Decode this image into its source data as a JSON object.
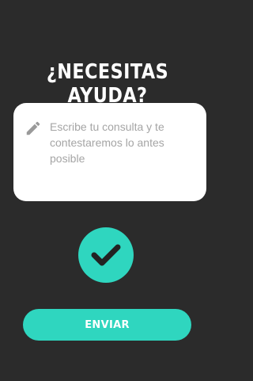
{
  "colors": {
    "background": "#2b2b2b",
    "accent": "#2fd6bf",
    "card": "#ffffff",
    "placeholder": "#a5a5a5"
  },
  "header": {
    "title": "¿NECESITAS AYUDA?"
  },
  "form": {
    "message_placeholder": "Escribe tu consulta y te contestaremos lo antes posible",
    "message_value": "",
    "edit_icon": "pencil-icon"
  },
  "status": {
    "icon": "check-icon"
  },
  "actions": {
    "send_label": "ENVIAR"
  }
}
